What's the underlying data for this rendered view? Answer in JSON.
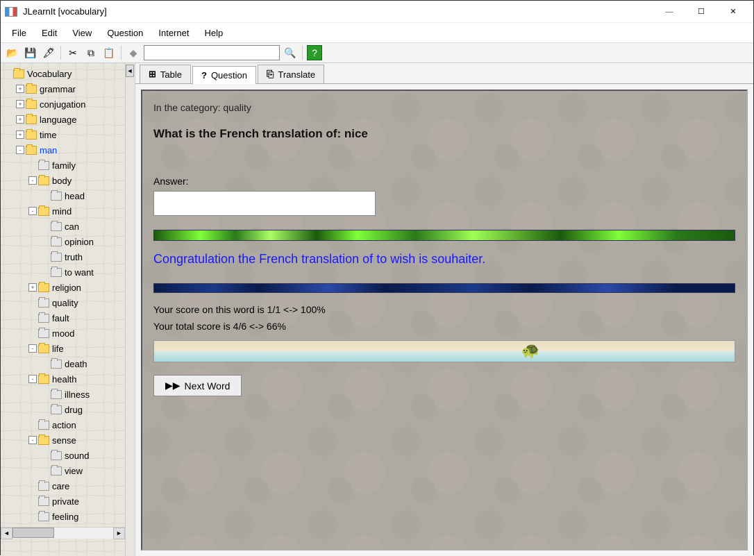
{
  "window": {
    "title": "JLearnIt [vocabulary]"
  },
  "menus": [
    "File",
    "Edit",
    "View",
    "Question",
    "Internet",
    "Help"
  ],
  "toolbar": {
    "search_value": ""
  },
  "tree": {
    "root": "Vocabulary",
    "items": [
      {
        "label": "grammar",
        "lvl": 1,
        "exp": "+",
        "icon": "folder"
      },
      {
        "label": "conjugation",
        "lvl": 1,
        "exp": "+",
        "icon": "folder"
      },
      {
        "label": "language",
        "lvl": 1,
        "exp": "+",
        "icon": "folder"
      },
      {
        "label": "time",
        "lvl": 1,
        "exp": "+",
        "icon": "folder"
      },
      {
        "label": "man",
        "lvl": 1,
        "exp": "-",
        "icon": "folder",
        "selected": true
      },
      {
        "label": "family",
        "lvl": 2,
        "exp": " ",
        "icon": "closed"
      },
      {
        "label": "body",
        "lvl": 2,
        "exp": "-",
        "icon": "folder"
      },
      {
        "label": "head",
        "lvl": 3,
        "exp": " ",
        "icon": "closed"
      },
      {
        "label": "mind",
        "lvl": 2,
        "exp": "-",
        "icon": "folder"
      },
      {
        "label": "can",
        "lvl": 3,
        "exp": " ",
        "icon": "closed"
      },
      {
        "label": "opinion",
        "lvl": 3,
        "exp": " ",
        "icon": "closed"
      },
      {
        "label": "truth",
        "lvl": 3,
        "exp": " ",
        "icon": "closed"
      },
      {
        "label": "to want",
        "lvl": 3,
        "exp": " ",
        "icon": "closed"
      },
      {
        "label": "religion",
        "lvl": 2,
        "exp": "+",
        "icon": "folder"
      },
      {
        "label": "quality",
        "lvl": 2,
        "exp": " ",
        "icon": "closed"
      },
      {
        "label": "fault",
        "lvl": 2,
        "exp": " ",
        "icon": "closed"
      },
      {
        "label": "mood",
        "lvl": 2,
        "exp": " ",
        "icon": "closed"
      },
      {
        "label": "life",
        "lvl": 2,
        "exp": "-",
        "icon": "folder"
      },
      {
        "label": "death",
        "lvl": 3,
        "exp": " ",
        "icon": "closed"
      },
      {
        "label": "health",
        "lvl": 2,
        "exp": "-",
        "icon": "folder"
      },
      {
        "label": "illness",
        "lvl": 3,
        "exp": " ",
        "icon": "closed"
      },
      {
        "label": "drug",
        "lvl": 3,
        "exp": " ",
        "icon": "closed"
      },
      {
        "label": "action",
        "lvl": 2,
        "exp": " ",
        "icon": "closed"
      },
      {
        "label": "sense",
        "lvl": 2,
        "exp": "-",
        "icon": "folder"
      },
      {
        "label": "sound",
        "lvl": 3,
        "exp": " ",
        "icon": "closed"
      },
      {
        "label": "view",
        "lvl": 3,
        "exp": " ",
        "icon": "closed"
      },
      {
        "label": "care",
        "lvl": 2,
        "exp": " ",
        "icon": "closed"
      },
      {
        "label": "private",
        "lvl": 2,
        "exp": " ",
        "icon": "closed"
      },
      {
        "label": "feeling",
        "lvl": 2,
        "exp": " ",
        "icon": "closed"
      }
    ]
  },
  "tabs": [
    {
      "label": "Table",
      "icon": "⊞"
    },
    {
      "label": "Question",
      "icon": "?",
      "active": true
    },
    {
      "label": "Translate",
      "icon": "⎘"
    }
  ],
  "content": {
    "category_line": "In the category: quality",
    "question": "What is the French translation of: nice",
    "answer_label": "Answer:",
    "answer_value": "",
    "congrats": "Congratulation the French translation of to wish is souhaiter.",
    "score_word": "Your score on this word is 1/1 <-> 100%",
    "score_total": "Your total score is 4/6 <-> 66%",
    "next_label": "Next Word"
  }
}
